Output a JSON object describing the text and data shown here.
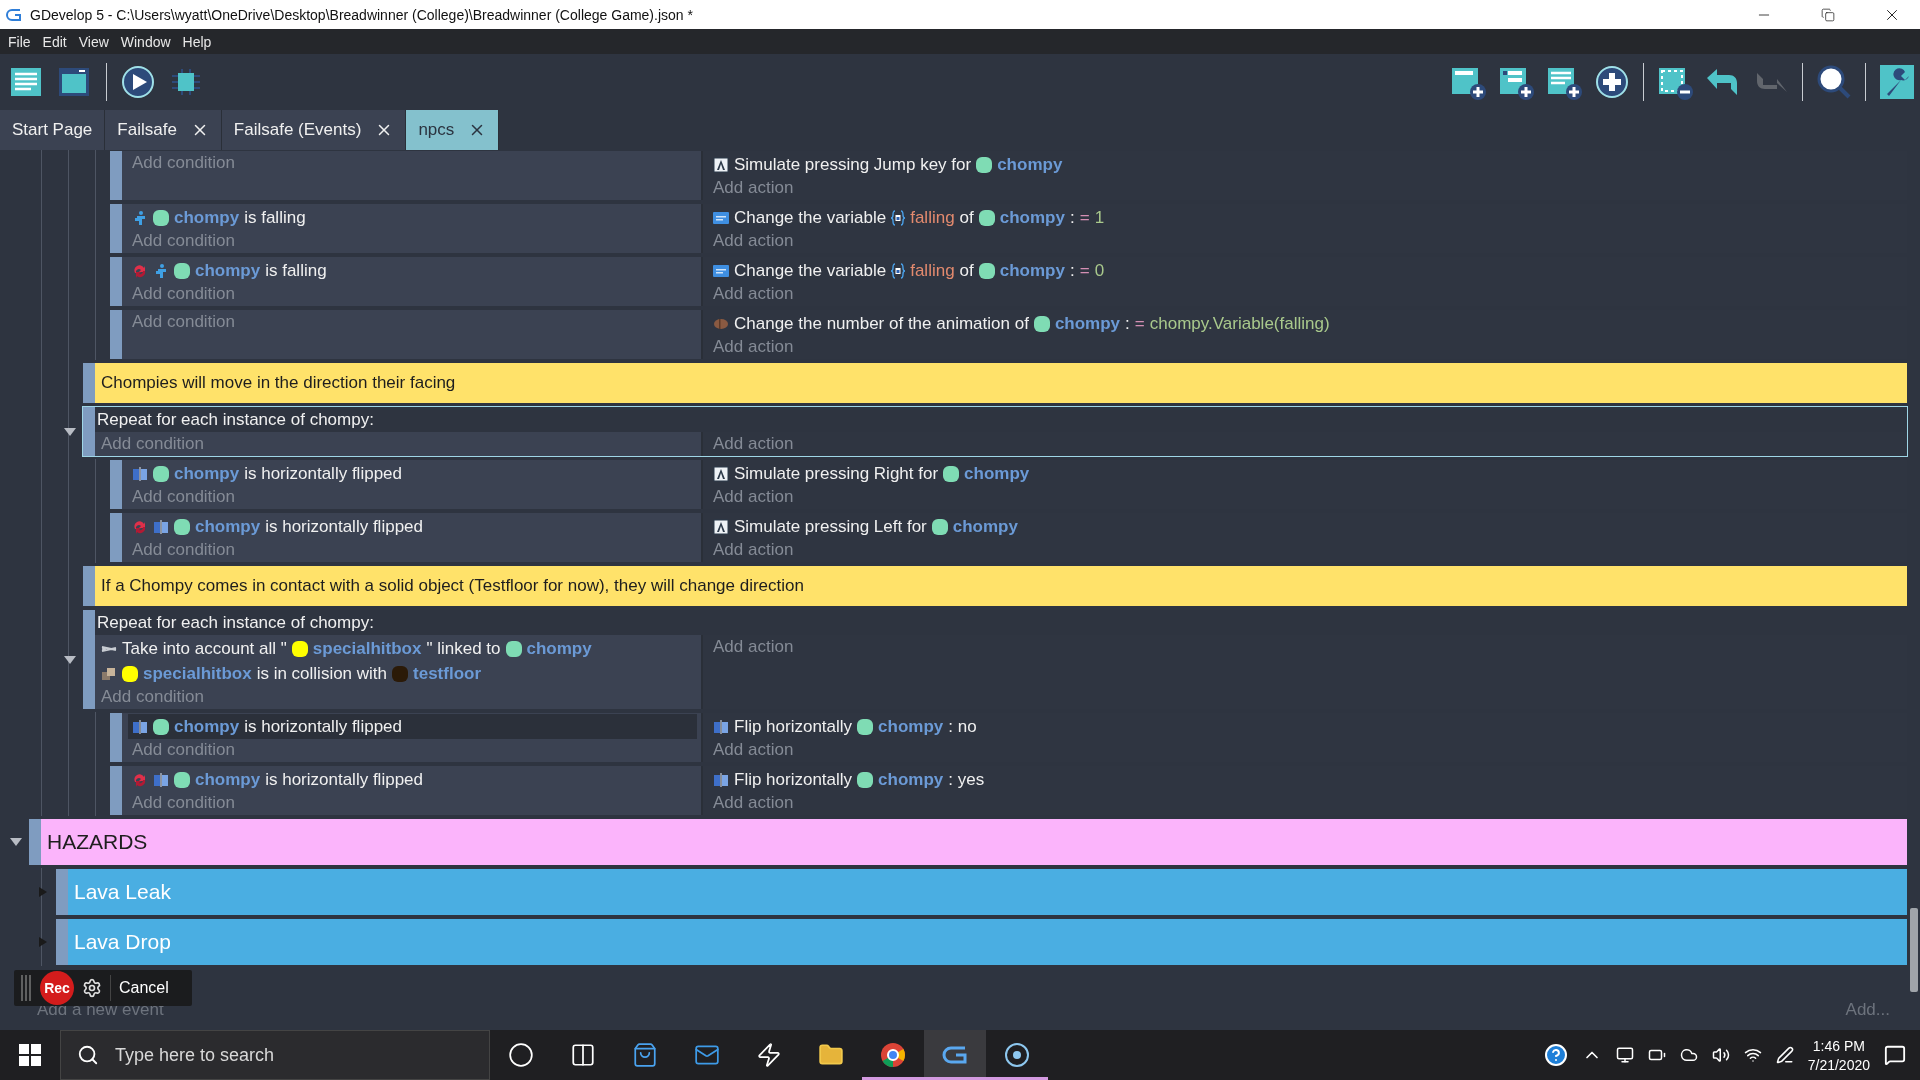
{
  "window": {
    "title": "GDevelop 5 - C:\\Users\\wyatt\\OneDrive\\Desktop\\Breadwinner (College)\\Breadwinner (College Game).json *"
  },
  "menu": [
    "File",
    "Edit",
    "View",
    "Window",
    "Help"
  ],
  "toolbar": {
    "left": [
      {
        "kind": "events-sheet"
      },
      {
        "kind": "scene"
      },
      {
        "kind": "separator"
      },
      {
        "kind": "preview"
      },
      {
        "kind": "debug"
      }
    ],
    "right": [
      {
        "kind": "add-event",
        "disabled": false
      },
      {
        "kind": "add-subevent",
        "disabled": false
      },
      {
        "kind": "add-comment",
        "disabled": false
      },
      {
        "kind": "add-other",
        "disabled": false
      },
      {
        "kind": "separator"
      },
      {
        "kind": "delete",
        "disabled": false
      },
      {
        "kind": "undo",
        "disabled": false
      },
      {
        "kind": "redo",
        "disabled": true
      },
      {
        "kind": "separator"
      },
      {
        "kind": "search",
        "disabled": false
      },
      {
        "kind": "separator"
      },
      {
        "kind": "settings",
        "disabled": false
      }
    ]
  },
  "tabs": [
    {
      "label": "Start Page",
      "selected": false,
      "closable": false
    },
    {
      "label": "Failsafe",
      "selected": false,
      "closable": true
    },
    {
      "label": "Failsafe (Events)",
      "selected": false,
      "closable": true
    },
    {
      "label": "npcs",
      "selected": true,
      "closable": true
    }
  ],
  "events": [
    {
      "kind": "container",
      "children": [
        {
          "kind": "container",
          "children": [
            {
              "kind": "container",
              "children": [
                {
                  "kind": "standard",
                  "selected": false,
                  "add_condition": "Add condition",
                  "actions": [
                    {
                      "kind": "keyboard",
                      "segments": [
                        {
                          "kind": "text",
                          "text": "Simulate pressing Jump key for"
                        },
                        {
                          "kind": "object",
                          "text": "chompy",
                          "color": "#7fdcb4"
                        }
                      ]
                    }
                  ],
                  "add_action": "Add action"
                },
                {
                  "kind": "standard",
                  "selected": false,
                  "conditions": [
                    {
                      "kind": "behavior",
                      "inverted": false,
                      "selected": false,
                      "segments": [
                        {
                          "kind": "object",
                          "text": "chompy",
                          "color": "#7fdcb4"
                        },
                        {
                          "kind": "text",
                          "text": "is falling"
                        }
                      ]
                    }
                  ],
                  "add_condition": "Add condition",
                  "actions": [
                    {
                      "kind": "variable",
                      "segments": [
                        {
                          "kind": "text",
                          "text": "Change the variable"
                        },
                        {
                          "kind": "variable",
                          "text": "falling"
                        },
                        {
                          "kind": "text",
                          "text": "of"
                        },
                        {
                          "kind": "object",
                          "text": "chompy",
                          "color": "#7fdcb4"
                        },
                        {
                          "kind": "text",
                          "text": ":"
                        },
                        {
                          "kind": "operator",
                          "text": "="
                        },
                        {
                          "kind": "value",
                          "text": "1"
                        }
                      ]
                    }
                  ],
                  "add_action": "Add action"
                },
                {
                  "kind": "standard",
                  "selected": false,
                  "conditions": [
                    {
                      "kind": "behavior",
                      "inverted": true,
                      "selected": false,
                      "segments": [
                        {
                          "kind": "object",
                          "text": "chompy",
                          "color": "#7fdcb4"
                        },
                        {
                          "kind": "text",
                          "text": "is falling"
                        }
                      ]
                    }
                  ],
                  "add_condition": "Add condition",
                  "actions": [
                    {
                      "kind": "variable",
                      "segments": [
                        {
                          "kind": "text",
                          "text": "Change the variable"
                        },
                        {
                          "kind": "variable",
                          "text": "falling"
                        },
                        {
                          "kind": "text",
                          "text": "of"
                        },
                        {
                          "kind": "object",
                          "text": "chompy",
                          "color": "#7fdcb4"
                        },
                        {
                          "kind": "text",
                          "text": ":"
                        },
                        {
                          "kind": "operator",
                          "text": "="
                        },
                        {
                          "kind": "value",
                          "text": "0"
                        }
                      ]
                    }
                  ],
                  "add_action": "Add action"
                },
                {
                  "kind": "standard",
                  "selected": false,
                  "add_condition": "Add condition",
                  "actions": [
                    {
                      "kind": "animation",
                      "segments": [
                        {
                          "kind": "text",
                          "text": "Change the number of the animation of"
                        },
                        {
                          "kind": "object",
                          "text": "chompy",
                          "color": "#7fdcb4"
                        },
                        {
                          "kind": "text",
                          "text": ":"
                        },
                        {
                          "kind": "operator",
                          "text": "="
                        },
                        {
                          "kind": "value",
                          "text": "chompy.Variable(falling)"
                        }
                      ]
                    }
                  ],
                  "add_action": "Add action"
                }
              ]
            },
            {
              "kind": "comment",
              "selected": false,
              "text": "Chompies will move in the direction their facing"
            },
            {
              "kind": "repeat",
              "selected": true,
              "expanded": true,
              "header": "Repeat for each instance of chompy:",
              "add_condition": "Add condition",
              "add_action": "Add action",
              "children": [
                {
                  "kind": "standard",
                  "selected": false,
                  "conditions": [
                    {
                      "kind": "flip",
                      "inverted": false,
                      "selected": false,
                      "segments": [
                        {
                          "kind": "object",
                          "text": "chompy",
                          "color": "#7fdcb4"
                        },
                        {
                          "kind": "text",
                          "text": "is horizontally flipped"
                        }
                      ]
                    }
                  ],
                  "add_condition": "Add condition",
                  "actions": [
                    {
                      "kind": "keyboard",
                      "segments": [
                        {
                          "kind": "text",
                          "text": "Simulate pressing Right for"
                        },
                        {
                          "kind": "object",
                          "text": "chompy",
                          "color": "#7fdcb4"
                        }
                      ]
                    }
                  ],
                  "add_action": "Add action"
                },
                {
                  "kind": "standard",
                  "selected": false,
                  "conditions": [
                    {
                      "kind": "flip",
                      "inverted": true,
                      "selected": false,
                      "segments": [
                        {
                          "kind": "object",
                          "text": "chompy",
                          "color": "#7fdcb4"
                        },
                        {
                          "kind": "text",
                          "text": "is horizontally flipped"
                        }
                      ]
                    }
                  ],
                  "add_condition": "Add condition",
                  "actions": [
                    {
                      "kind": "keyboard",
                      "segments": [
                        {
                          "kind": "text",
                          "text": "Simulate pressing Left for"
                        },
                        {
                          "kind": "object",
                          "text": "chompy",
                          "color": "#7fdcb4"
                        }
                      ]
                    }
                  ],
                  "add_action": "Add action"
                }
              ]
            },
            {
              "kind": "comment",
              "selected": false,
              "text": "If a Chompy comes in contact with a solid object (Testfloor for now), they will change direction"
            },
            {
              "kind": "repeat",
              "selected": false,
              "expanded": true,
              "header": "Repeat for each instance of chompy:",
              "conditions": [
                {
                  "kind": "link",
                  "inverted": false,
                  "selected": false,
                  "segments": [
                    {
                      "kind": "text",
                      "text": "Take into account all \""
                    },
                    {
                      "kind": "object",
                      "text": "specialhitbox",
                      "color": "#ffff00"
                    },
                    {
                      "kind": "text",
                      "text": "\" linked to"
                    },
                    {
                      "kind": "object",
                      "text": "chompy",
                      "color": "#7fdcb4"
                    }
                  ]
                },
                {
                  "kind": "collision",
                  "inverted": false,
                  "selected": false,
                  "segments": [
                    {
                      "kind": "object",
                      "text": "specialhitbox",
                      "color": "#ffff00"
                    },
                    {
                      "kind": "text",
                      "text": "is in collision with"
                    },
                    {
                      "kind": "object",
                      "text": "testfloor",
                      "color": "#2b1a08"
                    }
                  ]
                }
              ],
              "add_condition": "Add condition",
              "add_action": "Add action",
              "children": [
                {
                  "kind": "standard",
                  "selected": false,
                  "conditions": [
                    {
                      "kind": "flip",
                      "inverted": false,
                      "selected": true,
                      "segments": [
                        {
                          "kind": "object",
                          "text": "chompy",
                          "color": "#7fdcb4"
                        },
                        {
                          "kind": "text",
                          "text": "is horizontally flipped"
                        }
                      ]
                    }
                  ],
                  "add_condition": "Add condition",
                  "actions": [
                    {
                      "kind": "flip",
                      "segments": [
                        {
                          "kind": "text",
                          "text": "Flip horizontally"
                        },
                        {
                          "kind": "object",
                          "text": "chompy",
                          "color": "#7fdcb4"
                        },
                        {
                          "kind": "text",
                          "text": ": no"
                        }
                      ]
                    }
                  ],
                  "add_action": "Add action"
                },
                {
                  "kind": "standard",
                  "selected": false,
                  "conditions": [
                    {
                      "kind": "flip",
                      "inverted": true,
                      "selected": false,
                      "segments": [
                        {
                          "kind": "object",
                          "text": "chompy",
                          "color": "#7fdcb4"
                        },
                        {
                          "kind": "text",
                          "text": "is horizontally flipped"
                        }
                      ]
                    }
                  ],
                  "add_condition": "Add condition",
                  "actions": [
                    {
                      "kind": "flip",
                      "segments": [
                        {
                          "kind": "text",
                          "text": "Flip horizontally"
                        },
                        {
                          "kind": "object",
                          "text": "chompy",
                          "color": "#7fdcb4"
                        },
                        {
                          "kind": "text",
                          "text": ": yes"
                        }
                      ]
                    }
                  ],
                  "add_action": "Add action"
                }
              ]
            }
          ]
        }
      ]
    },
    {
      "kind": "group",
      "selected": false,
      "title": "HAZARDS",
      "color": "#fbb4fb",
      "expanded": true,
      "children": [
        {
          "kind": "group",
          "selected": false,
          "title": "Lava Leak",
          "color": "#4aaee2",
          "expanded": false
        },
        {
          "kind": "group",
          "selected": false,
          "title": "Lava Drop",
          "color": "#4aaee2",
          "expanded": false
        }
      ]
    }
  ],
  "add_event": "Add a new event",
  "add_more": "Add...",
  "recorder": {
    "record_label": "Rec",
    "cancel_label": "Cancel"
  },
  "taskbar": {
    "search_placeholder": "Type here to search",
    "apps": [
      {
        "kind": "cortana",
        "running": false,
        "selected": false
      },
      {
        "kind": "task-view",
        "running": false,
        "selected": false
      },
      {
        "kind": "store",
        "running": false,
        "selected": false
      },
      {
        "kind": "mail",
        "running": false,
        "selected": false
      },
      {
        "kind": "bolt",
        "running": false,
        "selected": false
      },
      {
        "kind": "explorer",
        "running": false,
        "selected": false
      },
      {
        "kind": "chrome",
        "running": true,
        "selected": false
      },
      {
        "kind": "gdevelop",
        "running": true,
        "selected": true
      },
      {
        "kind": "ring",
        "running": true,
        "selected": false
      }
    ],
    "time": "1:46 PM",
    "date": "7/21/2020"
  }
}
